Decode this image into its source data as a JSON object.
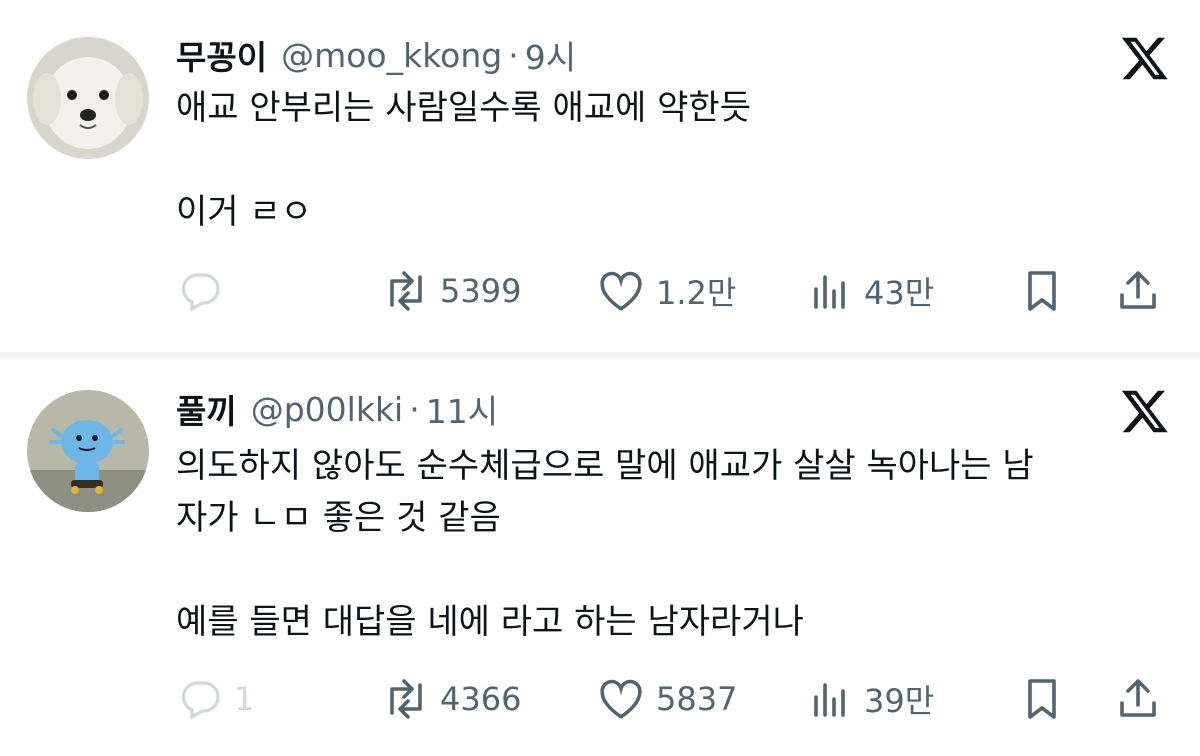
{
  "tweets": [
    {
      "name": "무꽁이",
      "handle": "@moo_kkong",
      "dot": "·",
      "time": "9시",
      "lines": [
        "애교 안부리는 사람일수록 애교에 약한듯",
        "",
        "이거 ㄹㅇ"
      ],
      "avatar_icon": "puppy-avatar-icon",
      "actions": {
        "reply_count": "",
        "retweet_count": "5399",
        "like_count": "1.2만",
        "views_count": "43만"
      }
    },
    {
      "name": "풀끼",
      "handle": "@p00lkki",
      "dot": "·",
      "time": "11시",
      "lines": [
        "의도하지 않아도 순수체급으로 말에 애교가 살살 녹아나는 남",
        "자가 ㄴㅁ 좋은 것 같음",
        "",
        "예를 들면 대답을 네에 라고 하는 남자라거나"
      ],
      "avatar_icon": "character-avatar-icon",
      "actions": {
        "reply_count": "1",
        "retweet_count": "4366",
        "like_count": "5837",
        "views_count": "39만"
      }
    }
  ],
  "icons": {
    "reply": "reply-icon",
    "retweet": "retweet-icon",
    "like": "heart-icon",
    "views": "views-icon",
    "bookmark": "bookmark-icon",
    "share": "share-icon",
    "logo": "x-logo-icon"
  },
  "colors": {
    "text": "#0f1419",
    "secondary": "#536471",
    "divider": "#eff3f4"
  }
}
